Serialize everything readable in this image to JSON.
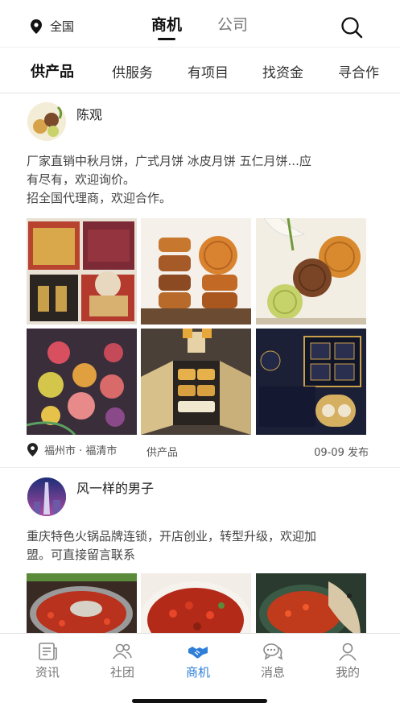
{
  "header": {
    "location_label": "全国",
    "tabs": [
      {
        "label": "商机",
        "active": true
      },
      {
        "label": "公司",
        "active": false
      }
    ],
    "search_icon": "search-icon"
  },
  "subtabs": [
    {
      "label": "供产品",
      "active": true
    },
    {
      "label": "供服务",
      "active": false
    },
    {
      "label": "有项目",
      "active": false
    },
    {
      "label": "找资金",
      "active": false
    },
    {
      "label": "寻合作",
      "active": false
    }
  ],
  "posts": [
    {
      "author": "陈观",
      "avatar_icon": "mooncake-avatar",
      "text_lines": [
        "厂家直销中秋月饼，广式月饼 冰皮月饼 五仁月饼...应",
        "有尽有，欢迎询价。",
        "招全国代理商，欢迎合作。"
      ],
      "photos": [
        "mooncake-giftbox-photo",
        "mooncake-stack-photo",
        "mooncake-lily-photo",
        "snowskin-mooncake-photo",
        "mooncake-tray-photo",
        "navy-giftbox-photo"
      ],
      "city": "福州市 · 福清市",
      "category": "供产品",
      "date": "09-09 发布"
    },
    {
      "author": "风一样的男子",
      "avatar_icon": "city-tower-avatar",
      "text_lines": [
        "重庆特色火锅品牌连锁，开店创业，转型升级，欢迎加",
        "盟。可直接留言联系"
      ],
      "photos": [
        "hotpot-photo",
        "chili-dish-photo",
        "fish-dish-photo"
      ]
    }
  ],
  "bottom_nav": [
    {
      "label": "资讯",
      "icon": "news-icon",
      "active": false
    },
    {
      "label": "社团",
      "icon": "group-icon",
      "active": false
    },
    {
      "label": "商机",
      "icon": "handshake-icon",
      "active": true
    },
    {
      "label": "消息",
      "icon": "message-icon",
      "active": false
    },
    {
      "label": "我的",
      "icon": "profile-icon",
      "active": false
    }
  ],
  "colors": {
    "accent": "#2f7fd8",
    "text": "#222222",
    "muted": "#777777",
    "divider": "#ececec"
  }
}
